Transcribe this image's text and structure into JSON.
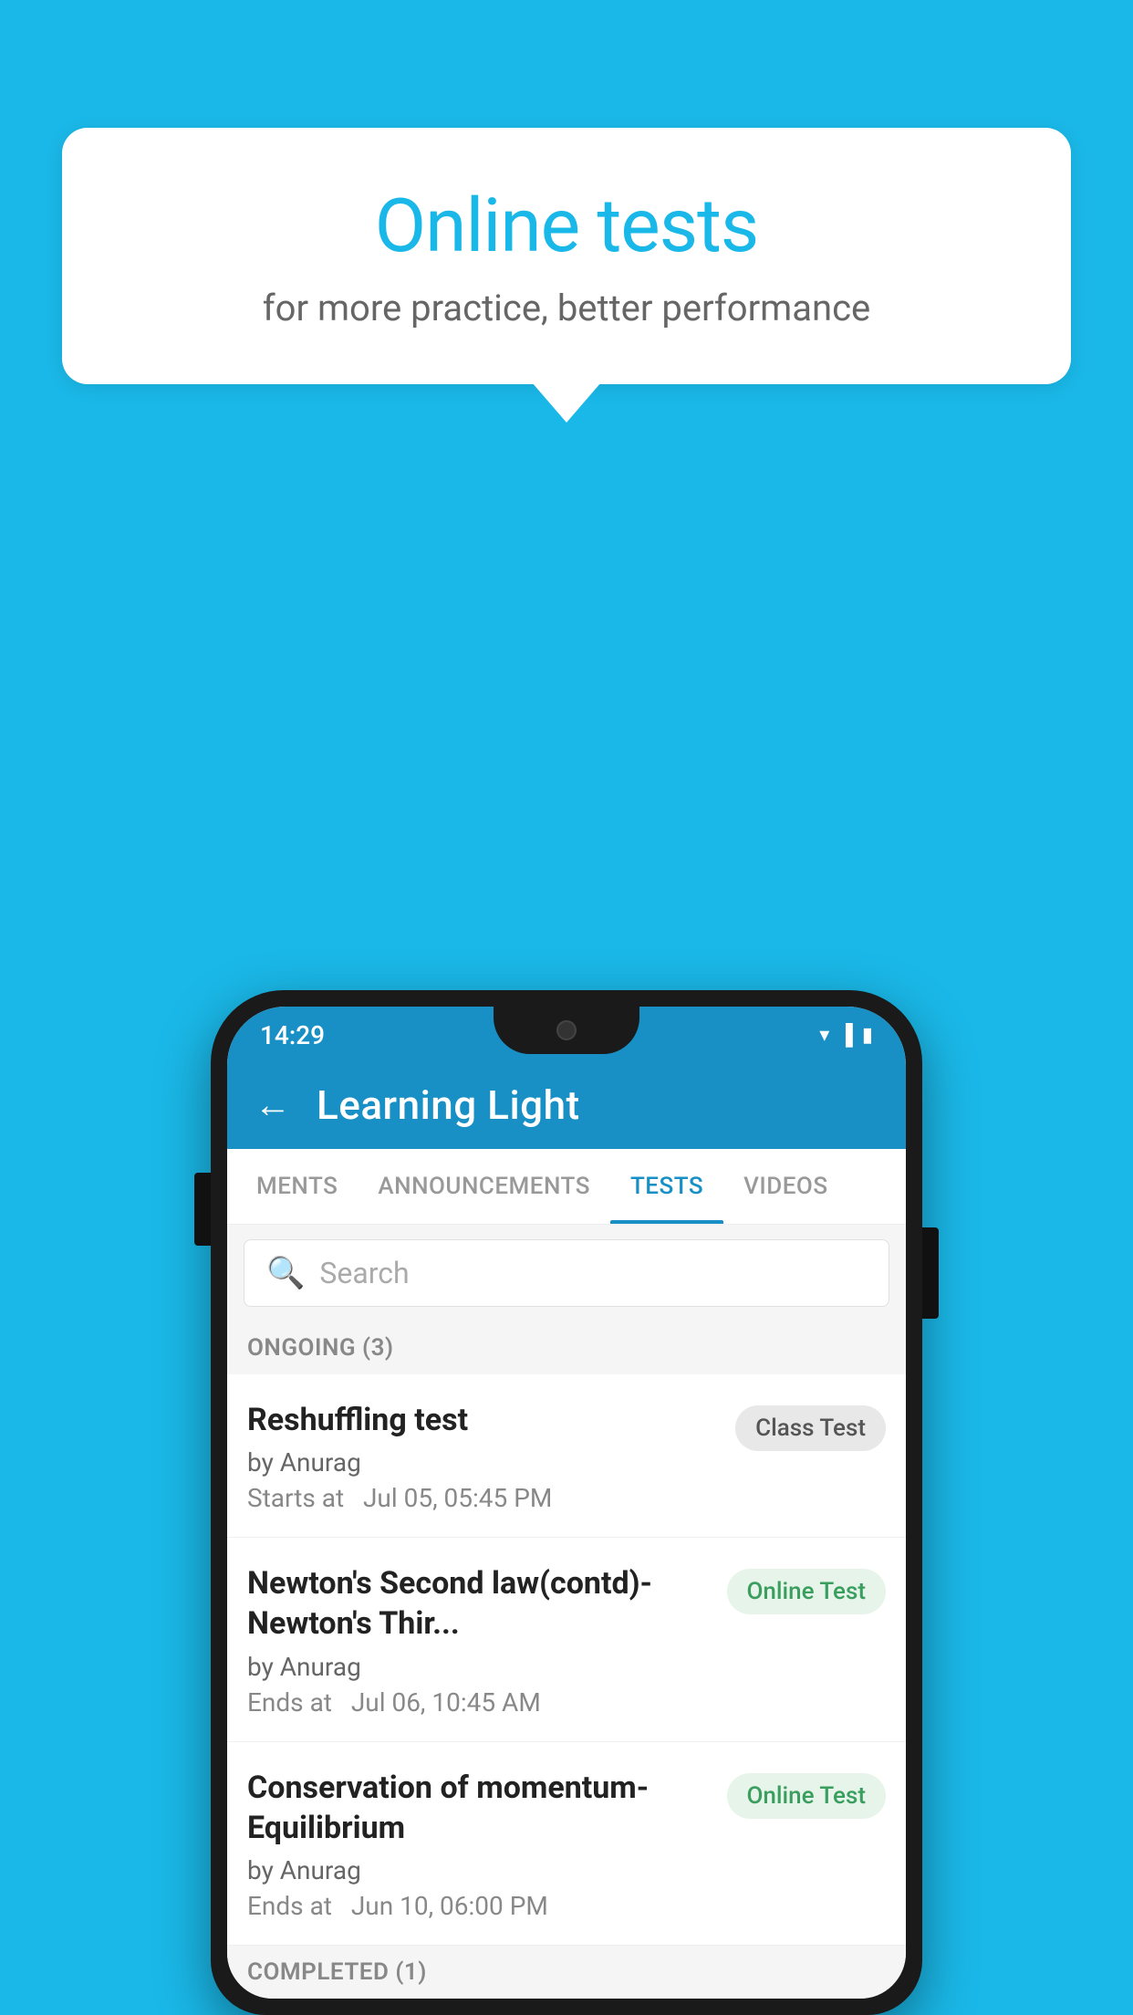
{
  "background_color": "#1AB8E8",
  "speech_bubble": {
    "title": "Online tests",
    "subtitle": "for more practice, better performance"
  },
  "phone": {
    "status_bar": {
      "time": "14:29",
      "icons": [
        "wifi",
        "signal",
        "battery"
      ]
    },
    "app_header": {
      "title": "Learning Light",
      "back_label": "←"
    },
    "tabs": [
      {
        "label": "MENTS",
        "active": false
      },
      {
        "label": "ANNOUNCEMENTS",
        "active": false
      },
      {
        "label": "TESTS",
        "active": true
      },
      {
        "label": "VIDEOS",
        "active": false
      }
    ],
    "search": {
      "placeholder": "Search"
    },
    "sections": [
      {
        "label": "ONGOING (3)",
        "tests": [
          {
            "title": "Reshuffling test",
            "author": "by Anurag",
            "date_label": "Starts at",
            "date": "Jul 05, 05:45 PM",
            "badge": "Class Test",
            "badge_type": "class"
          },
          {
            "title": "Newton's Second law(contd)-Newton's Thir...",
            "author": "by Anurag",
            "date_label": "Ends at",
            "date": "Jul 06, 10:45 AM",
            "badge": "Online Test",
            "badge_type": "online"
          },
          {
            "title": "Conservation of momentum-Equilibrium",
            "author": "by Anurag",
            "date_label": "Ends at",
            "date": "Jun 10, 06:00 PM",
            "badge": "Online Test",
            "badge_type": "online"
          }
        ]
      },
      {
        "label": "COMPLETED (1)",
        "tests": []
      }
    ]
  }
}
